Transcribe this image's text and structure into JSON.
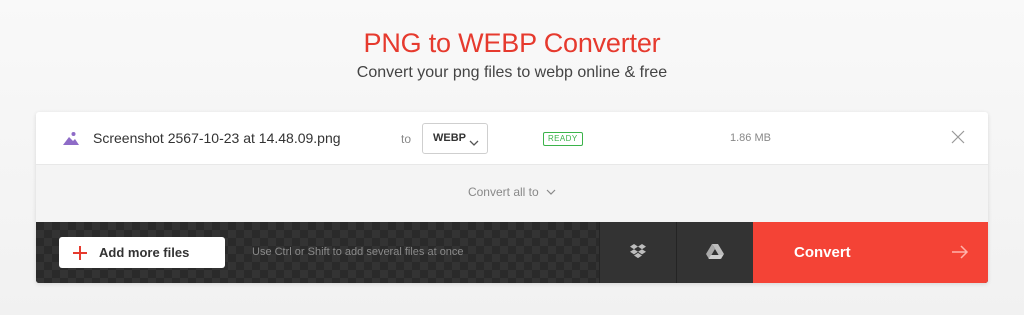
{
  "header": {
    "title": "PNG to WEBP Converter",
    "subtitle": "Convert your png files to webp online & free"
  },
  "file": {
    "name": "Screenshot 2567-10-23 at 14.48.09.png",
    "to_label": "to",
    "format": "WEBP",
    "status": "READY",
    "size": "1.86 MB"
  },
  "convert_all_label": "Convert all to",
  "actions": {
    "add_files_label": "Add more files",
    "hint": "Use Ctrl or Shift to add several files at once",
    "convert_label": "Convert"
  },
  "colors": {
    "accent": "#e63a2e",
    "convert_button": "#f44336",
    "ready_badge": "#3bb34a",
    "file_icon": "#8e6bc7"
  },
  "icons": [
    "image-file-icon",
    "chevron-down-icon",
    "close-icon",
    "plus-icon",
    "dropbox-icon",
    "google-drive-icon",
    "arrow-right-icon"
  ]
}
